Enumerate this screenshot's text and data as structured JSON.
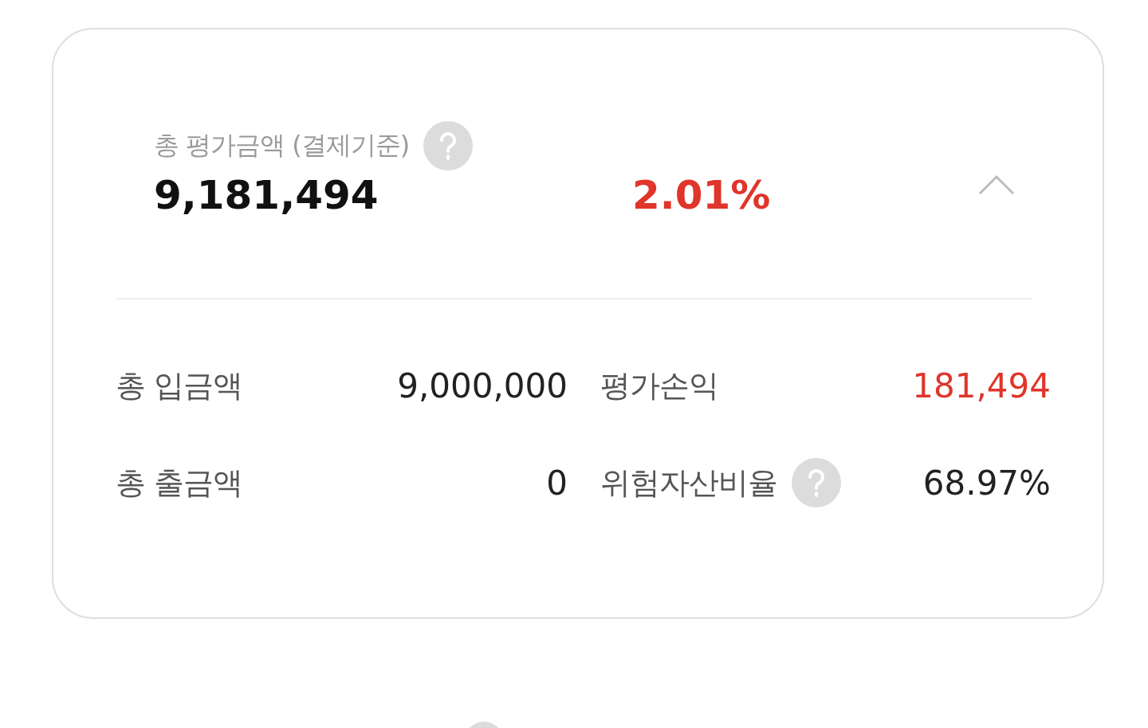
{
  "summary": {
    "label": "총 평가금액 (결제기준)",
    "help": true,
    "value": "9,181,494",
    "rate": "2.01%",
    "expanded": true
  },
  "stats": [
    {
      "label": "총 입금액",
      "value": "9,000,000",
      "help": false,
      "kind": "plain"
    },
    {
      "label": "평가손익",
      "value": "181,494",
      "help": false,
      "kind": "gain"
    },
    {
      "label": "총 출금액",
      "value": "0",
      "help": false,
      "kind": "plain"
    },
    {
      "label": "위험자산비율",
      "value": "68.97%",
      "help": true,
      "kind": "plain"
    }
  ]
}
